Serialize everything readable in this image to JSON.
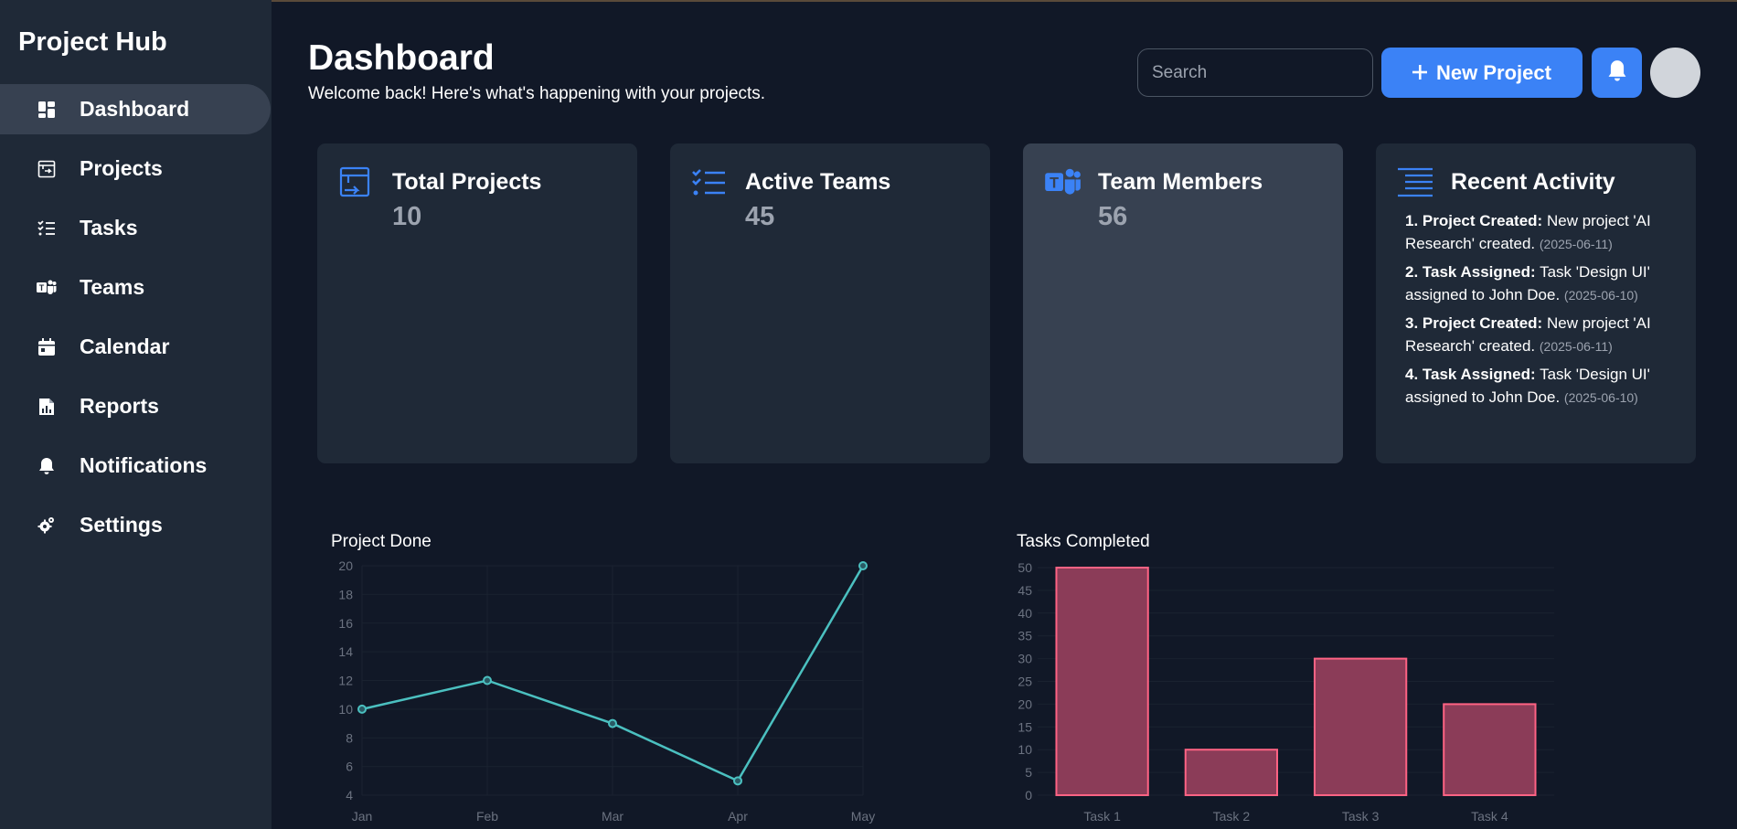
{
  "sidebar": {
    "brand": "Project Hub",
    "items": [
      {
        "label": "Dashboard",
        "icon": "dashboard-icon",
        "active": true
      },
      {
        "label": "Projects",
        "icon": "projects-icon"
      },
      {
        "label": "Tasks",
        "icon": "tasks-icon"
      },
      {
        "label": "Teams",
        "icon": "teams-icon"
      },
      {
        "label": "Calendar",
        "icon": "calendar-icon"
      },
      {
        "label": "Reports",
        "icon": "reports-icon"
      },
      {
        "label": "Notifications",
        "icon": "bell-icon"
      },
      {
        "label": "Settings",
        "icon": "gear-icon"
      }
    ]
  },
  "header": {
    "title": "Dashboard",
    "subtitle": "Welcome back! Here's what's happening with your projects.",
    "search_placeholder": "Search",
    "new_project_label": "New Project"
  },
  "cards": [
    {
      "title": "Total Projects",
      "value": "10",
      "icon": "projects-icon"
    },
    {
      "title": "Active Teams",
      "value": "45",
      "icon": "checklist-icon"
    },
    {
      "title": "Team Members",
      "value": "56",
      "icon": "teams-icon"
    }
  ],
  "activity": {
    "title": "Recent Activity",
    "icon": "list-icon",
    "items": [
      {
        "prefix": "1. Project Created:",
        "text": " New project 'AI Research' created. ",
        "date": "(2025-06-11)"
      },
      {
        "prefix": "2. Task Assigned:",
        "text": " Task 'Design UI' assigned to John Doe. ",
        "date": "(2025-06-10)"
      },
      {
        "prefix": "3. Project Created:",
        "text": " New project 'AI Research' created. ",
        "date": "(2025-06-11)"
      },
      {
        "prefix": "4. Task Assigned:",
        "text": " Task 'Design UI' assigned to John Doe. ",
        "date": "(2025-06-10)"
      }
    ]
  },
  "colors": {
    "accent": "#3b82f6",
    "line": "#4bc0c0",
    "bar_fill": "#8b3c58",
    "bar_stroke": "#ff6384"
  },
  "chart_data": [
    {
      "type": "line",
      "title": "Project Done",
      "categories": [
        "Jan",
        "Feb",
        "Mar",
        "Apr",
        "May"
      ],
      "values": [
        10,
        12,
        9,
        5,
        20
      ],
      "yticks": [
        4,
        6,
        8,
        10,
        12,
        14,
        16,
        18,
        20
      ],
      "ylim": [
        4,
        20
      ],
      "grid": true,
      "legend": "none"
    },
    {
      "type": "bar",
      "title": "Tasks Completed",
      "categories": [
        "Task 1",
        "Task 2",
        "Task 3",
        "Task 4"
      ],
      "values": [
        50,
        10,
        30,
        20
      ],
      "yticks": [
        0,
        5,
        10,
        15,
        20,
        25,
        30,
        35,
        40,
        45,
        50
      ],
      "ylim": [
        0,
        50
      ],
      "grid": true,
      "legend": "none"
    }
  ]
}
